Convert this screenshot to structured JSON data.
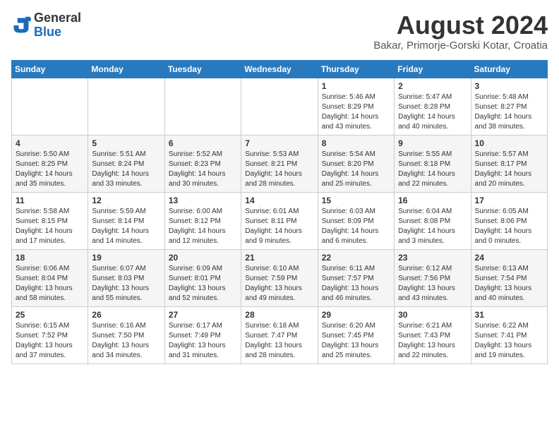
{
  "header": {
    "logo_general": "General",
    "logo_blue": "Blue",
    "month_year": "August 2024",
    "location": "Bakar, Primorje-Gorski Kotar, Croatia"
  },
  "days_of_week": [
    "Sunday",
    "Monday",
    "Tuesday",
    "Wednesday",
    "Thursday",
    "Friday",
    "Saturday"
  ],
  "weeks": [
    [
      {
        "day": "",
        "detail": ""
      },
      {
        "day": "",
        "detail": ""
      },
      {
        "day": "",
        "detail": ""
      },
      {
        "day": "",
        "detail": ""
      },
      {
        "day": "1",
        "detail": "Sunrise: 5:46 AM\nSunset: 8:29 PM\nDaylight: 14 hours\nand 43 minutes."
      },
      {
        "day": "2",
        "detail": "Sunrise: 5:47 AM\nSunset: 8:28 PM\nDaylight: 14 hours\nand 40 minutes."
      },
      {
        "day": "3",
        "detail": "Sunrise: 5:48 AM\nSunset: 8:27 PM\nDaylight: 14 hours\nand 38 minutes."
      }
    ],
    [
      {
        "day": "4",
        "detail": "Sunrise: 5:50 AM\nSunset: 8:25 PM\nDaylight: 14 hours\nand 35 minutes."
      },
      {
        "day": "5",
        "detail": "Sunrise: 5:51 AM\nSunset: 8:24 PM\nDaylight: 14 hours\nand 33 minutes."
      },
      {
        "day": "6",
        "detail": "Sunrise: 5:52 AM\nSunset: 8:23 PM\nDaylight: 14 hours\nand 30 minutes."
      },
      {
        "day": "7",
        "detail": "Sunrise: 5:53 AM\nSunset: 8:21 PM\nDaylight: 14 hours\nand 28 minutes."
      },
      {
        "day": "8",
        "detail": "Sunrise: 5:54 AM\nSunset: 8:20 PM\nDaylight: 14 hours\nand 25 minutes."
      },
      {
        "day": "9",
        "detail": "Sunrise: 5:55 AM\nSunset: 8:18 PM\nDaylight: 14 hours\nand 22 minutes."
      },
      {
        "day": "10",
        "detail": "Sunrise: 5:57 AM\nSunset: 8:17 PM\nDaylight: 14 hours\nand 20 minutes."
      }
    ],
    [
      {
        "day": "11",
        "detail": "Sunrise: 5:58 AM\nSunset: 8:15 PM\nDaylight: 14 hours\nand 17 minutes."
      },
      {
        "day": "12",
        "detail": "Sunrise: 5:59 AM\nSunset: 8:14 PM\nDaylight: 14 hours\nand 14 minutes."
      },
      {
        "day": "13",
        "detail": "Sunrise: 6:00 AM\nSunset: 8:12 PM\nDaylight: 14 hours\nand 12 minutes."
      },
      {
        "day": "14",
        "detail": "Sunrise: 6:01 AM\nSunset: 8:11 PM\nDaylight: 14 hours\nand 9 minutes."
      },
      {
        "day": "15",
        "detail": "Sunrise: 6:03 AM\nSunset: 8:09 PM\nDaylight: 14 hours\nand 6 minutes."
      },
      {
        "day": "16",
        "detail": "Sunrise: 6:04 AM\nSunset: 8:08 PM\nDaylight: 14 hours\nand 3 minutes."
      },
      {
        "day": "17",
        "detail": "Sunrise: 6:05 AM\nSunset: 8:06 PM\nDaylight: 14 hours\nand 0 minutes."
      }
    ],
    [
      {
        "day": "18",
        "detail": "Sunrise: 6:06 AM\nSunset: 8:04 PM\nDaylight: 13 hours\nand 58 minutes."
      },
      {
        "day": "19",
        "detail": "Sunrise: 6:07 AM\nSunset: 8:03 PM\nDaylight: 13 hours\nand 55 minutes."
      },
      {
        "day": "20",
        "detail": "Sunrise: 6:09 AM\nSunset: 8:01 PM\nDaylight: 13 hours\nand 52 minutes."
      },
      {
        "day": "21",
        "detail": "Sunrise: 6:10 AM\nSunset: 7:59 PM\nDaylight: 13 hours\nand 49 minutes."
      },
      {
        "day": "22",
        "detail": "Sunrise: 6:11 AM\nSunset: 7:57 PM\nDaylight: 13 hours\nand 46 minutes."
      },
      {
        "day": "23",
        "detail": "Sunrise: 6:12 AM\nSunset: 7:56 PM\nDaylight: 13 hours\nand 43 minutes."
      },
      {
        "day": "24",
        "detail": "Sunrise: 6:13 AM\nSunset: 7:54 PM\nDaylight: 13 hours\nand 40 minutes."
      }
    ],
    [
      {
        "day": "25",
        "detail": "Sunrise: 6:15 AM\nSunset: 7:52 PM\nDaylight: 13 hours\nand 37 minutes."
      },
      {
        "day": "26",
        "detail": "Sunrise: 6:16 AM\nSunset: 7:50 PM\nDaylight: 13 hours\nand 34 minutes."
      },
      {
        "day": "27",
        "detail": "Sunrise: 6:17 AM\nSunset: 7:49 PM\nDaylight: 13 hours\nand 31 minutes."
      },
      {
        "day": "28",
        "detail": "Sunrise: 6:18 AM\nSunset: 7:47 PM\nDaylight: 13 hours\nand 28 minutes."
      },
      {
        "day": "29",
        "detail": "Sunrise: 6:20 AM\nSunset: 7:45 PM\nDaylight: 13 hours\nand 25 minutes."
      },
      {
        "day": "30",
        "detail": "Sunrise: 6:21 AM\nSunset: 7:43 PM\nDaylight: 13 hours\nand 22 minutes."
      },
      {
        "day": "31",
        "detail": "Sunrise: 6:22 AM\nSunset: 7:41 PM\nDaylight: 13 hours\nand 19 minutes."
      }
    ]
  ]
}
